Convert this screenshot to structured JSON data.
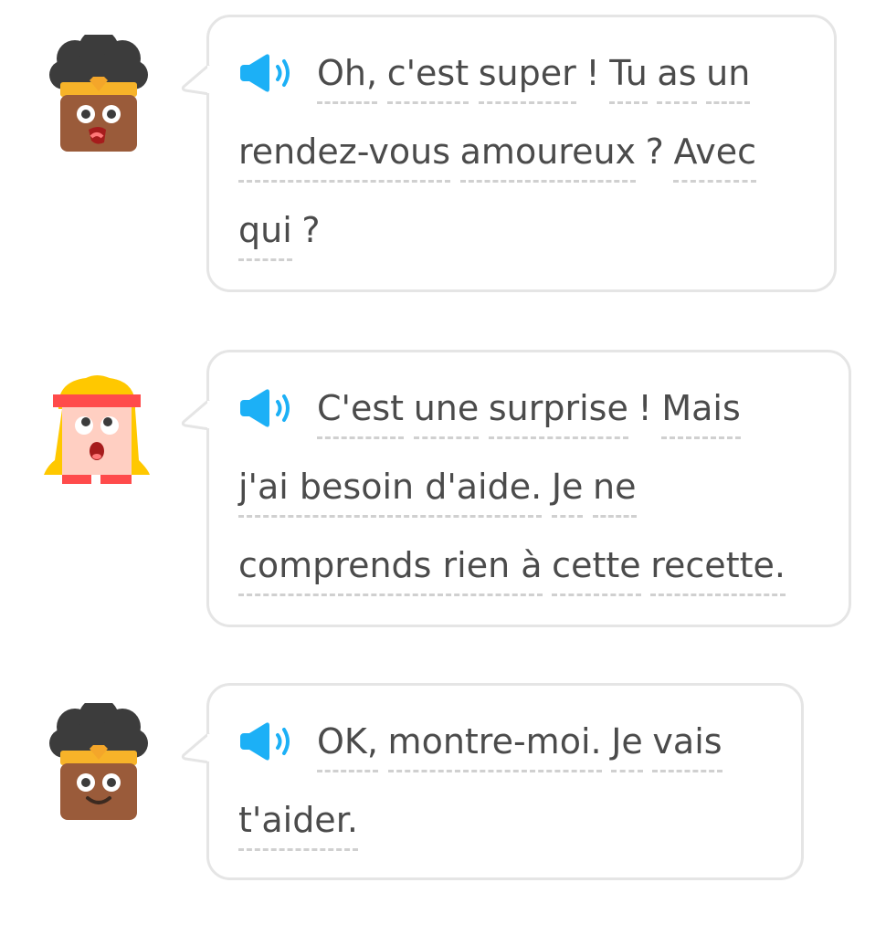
{
  "conversation": {
    "messages": [
      {
        "speaker": "bea",
        "lines": [
          [
            {
              "t": "Oh,",
              "w": true
            },
            {
              "t": "c'est",
              "w": true
            },
            {
              "t": "super",
              "w": true
            },
            {
              "t": "!",
              "w": false
            },
            {
              "t": "Tu",
              "w": true
            },
            {
              "t": "as",
              "w": true
            },
            {
              "t": "un",
              "w": true
            }
          ],
          [
            {
              "t": "rendez-vous",
              "w": true
            },
            {
              "t": "amoureux",
              "w": true
            },
            {
              "t": "?",
              "w": false
            },
            {
              "t": "Avec",
              "w": true
            }
          ],
          [
            {
              "t": "qui",
              "w": true
            },
            {
              "t": "?",
              "w": false
            }
          ]
        ]
      },
      {
        "speaker": "lily",
        "lines": [
          [
            {
              "t": "C'est",
              "w": true
            },
            {
              "t": "une",
              "w": true
            },
            {
              "t": "surprise",
              "w": true
            },
            {
              "t": "!",
              "w": false
            },
            {
              "t": "Mais",
              "w": true
            }
          ],
          [
            {
              "t": "j'ai besoin d'aide.",
              "w": true
            },
            {
              "t": "Je",
              "w": true
            },
            {
              "t": "ne",
              "w": true
            }
          ],
          [
            {
              "t": "comprends rien à",
              "w": true
            },
            {
              "t": "cette",
              "w": true
            },
            {
              "t": "recette.",
              "w": true
            }
          ]
        ]
      },
      {
        "speaker": "bea",
        "lines": [
          [
            {
              "t": "OK,",
              "w": true
            },
            {
              "t": "montre-moi.",
              "w": true
            },
            {
              "t": "Je",
              "w": true
            },
            {
              "t": "vais",
              "w": true
            }
          ],
          [
            {
              "t": "t'aider.",
              "w": true
            }
          ]
        ]
      }
    ]
  },
  "icons": {
    "speaker": "speaker-icon",
    "avatar_bea": "bea-avatar-icon",
    "avatar_lily": "lily-avatar-icon"
  },
  "colors": {
    "speaker_blue": "#1cb0f6",
    "bubble_border": "#e5e5e5",
    "text": "#4b4b4b",
    "underline": "#d0d0d0"
  }
}
